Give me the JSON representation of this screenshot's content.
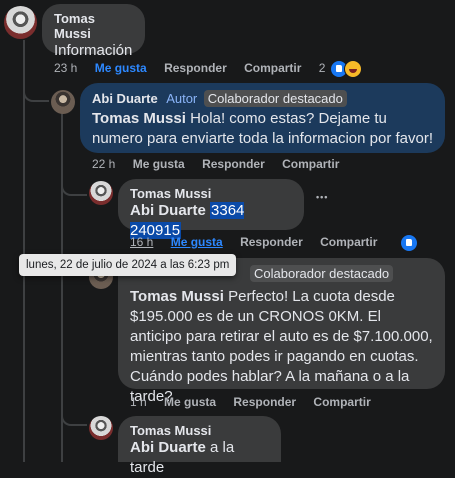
{
  "comments": [
    {
      "author": "Tomas Mussi",
      "text": "Información",
      "time": "23 h",
      "like": "Me gusta",
      "reply": "Responder",
      "share": "Compartir",
      "reaction_count": "2"
    },
    {
      "author": "Abi Duarte",
      "badge_author": "Autor",
      "badge_top": "Colaborador destacado",
      "mention": "Tomas Mussi",
      "text": "Hola! como estas? Dejame tu numero para enviarte toda la informacion por favor!",
      "time": "22 h",
      "like": "Me gusta",
      "reply": "Responder",
      "share": "Compartir"
    },
    {
      "author": "Tomas Mussi",
      "mention": "Abi Duarte",
      "text": "3364 240915",
      "time": "16 h",
      "like": "Me gusta",
      "reply": "Responder",
      "share": "Compartir",
      "more": "•••"
    },
    {
      "badge_top": "Colaborador destacado",
      "mention": "Tomas Mussi",
      "text": "Perfecto! La cuota desde $195.000 es de un CRONOS 0KM. El anticipo para retirar el auto es de $7.100.000, mientras tanto podes ir pagando en cuotas. Cuándo podes hablar? A la mañana o a la tarde?",
      "time": "1 h",
      "like": "Me gusta",
      "reply": "Responder",
      "share": "Compartir"
    },
    {
      "author": "Tomas Mussi",
      "mention": "Abi Duarte",
      "text": "a la tarde"
    }
  ],
  "tooltip": "lunes, 22 de julio de 2024 a las 6:23 pm",
  "colors": {
    "background": "#18191a",
    "bubble": "#3a3b3c",
    "highlight": "#1c3a5c",
    "link": "#2d88ff"
  }
}
